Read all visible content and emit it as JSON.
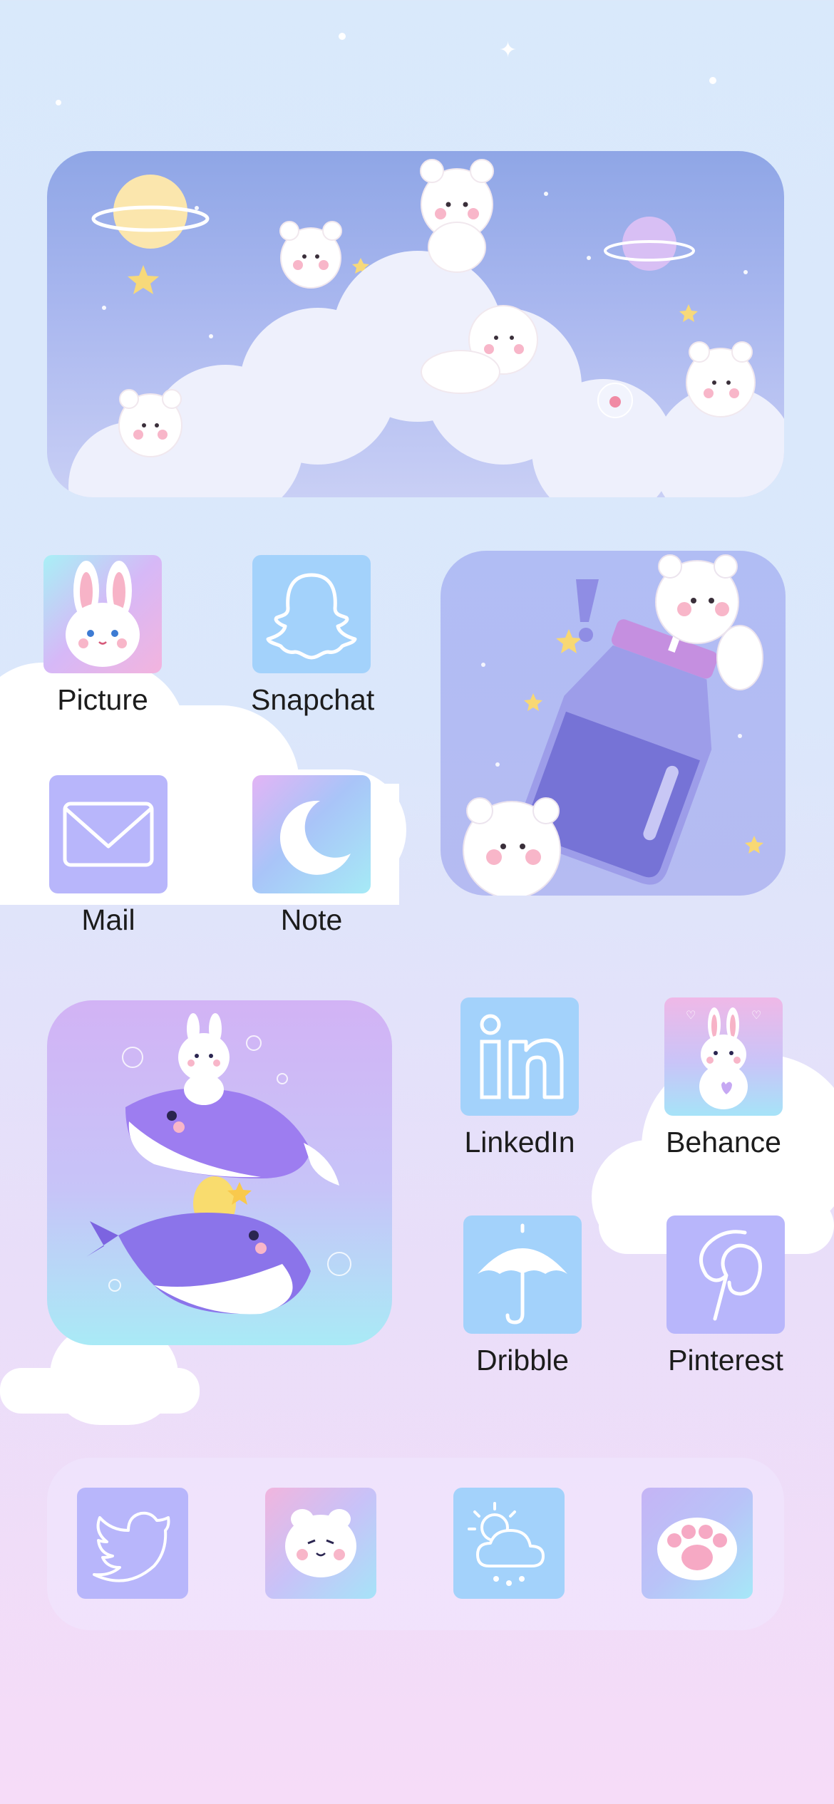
{
  "apps": {
    "picture": {
      "label": "Picture",
      "icon": "bunny-icon"
    },
    "snapchat": {
      "label": "Snapchat",
      "icon": "ghost-icon"
    },
    "mail": {
      "label": "Mail",
      "icon": "envelope-icon"
    },
    "note": {
      "label": "Note",
      "icon": "moon-icon"
    },
    "linkedin": {
      "label": "LinkedIn",
      "icon": "linkedin-icon"
    },
    "behance": {
      "label": "Behance",
      "icon": "bunny-sitting-icon"
    },
    "dribble": {
      "label": "Dribble",
      "icon": "umbrella-icon"
    },
    "pinterest": {
      "label": "Pinterest",
      "icon": "pinterest-icon"
    }
  },
  "dock": [
    {
      "icon": "twitter-bird-icon"
    },
    {
      "icon": "bunny-face-icon"
    },
    {
      "icon": "weather-icon"
    },
    {
      "icon": "paw-icon"
    }
  ],
  "widgets": {
    "top": "sky-bears-widget",
    "right": "bear-bottle-widget",
    "left": "whales-widget"
  },
  "colors": {
    "tile_blue": "#a3d2fb",
    "tile_lavender": "#b8b6fb",
    "background_top": "#d9e9fb",
    "background_bottom": "#f6dcf8"
  }
}
